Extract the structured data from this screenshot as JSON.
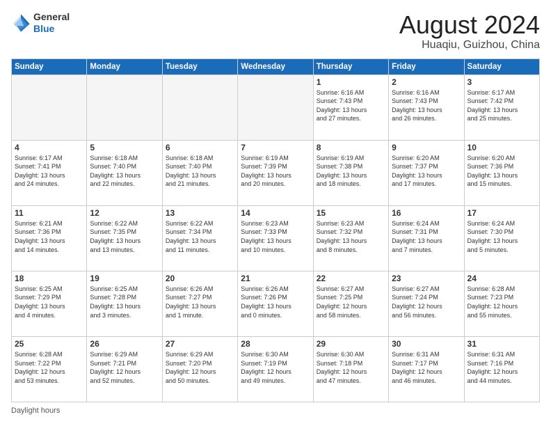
{
  "logo": {
    "line1": "General",
    "line2": "Blue"
  },
  "title": "August 2024",
  "subtitle": "Huaqiu, Guizhou, China",
  "days_of_week": [
    "Sunday",
    "Monday",
    "Tuesday",
    "Wednesday",
    "Thursday",
    "Friday",
    "Saturday"
  ],
  "footer_label": "Daylight hours",
  "weeks": [
    [
      {
        "day": "",
        "info": ""
      },
      {
        "day": "",
        "info": ""
      },
      {
        "day": "",
        "info": ""
      },
      {
        "day": "",
        "info": ""
      },
      {
        "day": "1",
        "info": "Sunrise: 6:16 AM\nSunset: 7:43 PM\nDaylight: 13 hours\nand 27 minutes."
      },
      {
        "day": "2",
        "info": "Sunrise: 6:16 AM\nSunset: 7:43 PM\nDaylight: 13 hours\nand 26 minutes."
      },
      {
        "day": "3",
        "info": "Sunrise: 6:17 AM\nSunset: 7:42 PM\nDaylight: 13 hours\nand 25 minutes."
      }
    ],
    [
      {
        "day": "4",
        "info": "Sunrise: 6:17 AM\nSunset: 7:41 PM\nDaylight: 13 hours\nand 24 minutes."
      },
      {
        "day": "5",
        "info": "Sunrise: 6:18 AM\nSunset: 7:40 PM\nDaylight: 13 hours\nand 22 minutes."
      },
      {
        "day": "6",
        "info": "Sunrise: 6:18 AM\nSunset: 7:40 PM\nDaylight: 13 hours\nand 21 minutes."
      },
      {
        "day": "7",
        "info": "Sunrise: 6:19 AM\nSunset: 7:39 PM\nDaylight: 13 hours\nand 20 minutes."
      },
      {
        "day": "8",
        "info": "Sunrise: 6:19 AM\nSunset: 7:38 PM\nDaylight: 13 hours\nand 18 minutes."
      },
      {
        "day": "9",
        "info": "Sunrise: 6:20 AM\nSunset: 7:37 PM\nDaylight: 13 hours\nand 17 minutes."
      },
      {
        "day": "10",
        "info": "Sunrise: 6:20 AM\nSunset: 7:36 PM\nDaylight: 13 hours\nand 15 minutes."
      }
    ],
    [
      {
        "day": "11",
        "info": "Sunrise: 6:21 AM\nSunset: 7:36 PM\nDaylight: 13 hours\nand 14 minutes."
      },
      {
        "day": "12",
        "info": "Sunrise: 6:22 AM\nSunset: 7:35 PM\nDaylight: 13 hours\nand 13 minutes."
      },
      {
        "day": "13",
        "info": "Sunrise: 6:22 AM\nSunset: 7:34 PM\nDaylight: 13 hours\nand 11 minutes."
      },
      {
        "day": "14",
        "info": "Sunrise: 6:23 AM\nSunset: 7:33 PM\nDaylight: 13 hours\nand 10 minutes."
      },
      {
        "day": "15",
        "info": "Sunrise: 6:23 AM\nSunset: 7:32 PM\nDaylight: 13 hours\nand 8 minutes."
      },
      {
        "day": "16",
        "info": "Sunrise: 6:24 AM\nSunset: 7:31 PM\nDaylight: 13 hours\nand 7 minutes."
      },
      {
        "day": "17",
        "info": "Sunrise: 6:24 AM\nSunset: 7:30 PM\nDaylight: 13 hours\nand 5 minutes."
      }
    ],
    [
      {
        "day": "18",
        "info": "Sunrise: 6:25 AM\nSunset: 7:29 PM\nDaylight: 13 hours\nand 4 minutes."
      },
      {
        "day": "19",
        "info": "Sunrise: 6:25 AM\nSunset: 7:28 PM\nDaylight: 13 hours\nand 3 minutes."
      },
      {
        "day": "20",
        "info": "Sunrise: 6:26 AM\nSunset: 7:27 PM\nDaylight: 13 hours\nand 1 minute."
      },
      {
        "day": "21",
        "info": "Sunrise: 6:26 AM\nSunset: 7:26 PM\nDaylight: 13 hours\nand 0 minutes."
      },
      {
        "day": "22",
        "info": "Sunrise: 6:27 AM\nSunset: 7:25 PM\nDaylight: 12 hours\nand 58 minutes."
      },
      {
        "day": "23",
        "info": "Sunrise: 6:27 AM\nSunset: 7:24 PM\nDaylight: 12 hours\nand 56 minutes."
      },
      {
        "day": "24",
        "info": "Sunrise: 6:28 AM\nSunset: 7:23 PM\nDaylight: 12 hours\nand 55 minutes."
      }
    ],
    [
      {
        "day": "25",
        "info": "Sunrise: 6:28 AM\nSunset: 7:22 PM\nDaylight: 12 hours\nand 53 minutes."
      },
      {
        "day": "26",
        "info": "Sunrise: 6:29 AM\nSunset: 7:21 PM\nDaylight: 12 hours\nand 52 minutes."
      },
      {
        "day": "27",
        "info": "Sunrise: 6:29 AM\nSunset: 7:20 PM\nDaylight: 12 hours\nand 50 minutes."
      },
      {
        "day": "28",
        "info": "Sunrise: 6:30 AM\nSunset: 7:19 PM\nDaylight: 12 hours\nand 49 minutes."
      },
      {
        "day": "29",
        "info": "Sunrise: 6:30 AM\nSunset: 7:18 PM\nDaylight: 12 hours\nand 47 minutes."
      },
      {
        "day": "30",
        "info": "Sunrise: 6:31 AM\nSunset: 7:17 PM\nDaylight: 12 hours\nand 46 minutes."
      },
      {
        "day": "31",
        "info": "Sunrise: 6:31 AM\nSunset: 7:16 PM\nDaylight: 12 hours\nand 44 minutes."
      }
    ]
  ]
}
